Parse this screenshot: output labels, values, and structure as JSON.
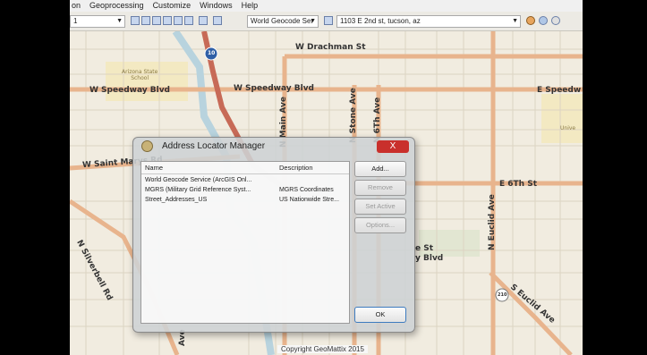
{
  "menubar": {
    "items": [
      "on",
      "Geoprocessing",
      "Customize",
      "Windows",
      "Help"
    ]
  },
  "toolbar": {
    "scale_fragment": "1",
    "locator_combo": "World Geocode Ser",
    "address_combo": "1103 E 2nd st, tucson, az"
  },
  "map": {
    "labels": {
      "drachman": "W Drachman St",
      "school": "Arizona State\nSchool",
      "speedway_w": "W Speedway Blvd",
      "speedway_mid": "W Speedway Blvd",
      "speedway_e": "E Speedw",
      "saint_marys": "W Saint Marys Rd",
      "sixth_e": "E 6Th St",
      "main_ave": "N Main Ave",
      "stone_ave": "N Stone Ave",
      "sixth_ave": "N 6Th Ave",
      "euclid_n": "N Euclid Ave",
      "euclid_s": "S Euclid Ave",
      "silverbell": "N Silverbell Rd",
      "st_frag": "e St",
      "blvd_frag": "y Blvd",
      "ave_frag": "Ave",
      "univ_frag": "Unive",
      "shield_10": "10",
      "shield_210": "210"
    }
  },
  "dialog": {
    "title": "Address Locator Manager",
    "close_label": "X",
    "columns": {
      "name": "Name",
      "description": "Description"
    },
    "rows": [
      {
        "name": "World Geocode Service (ArcGIS Onl...",
        "description": ""
      },
      {
        "name": "MGRS (Military Grid Reference Syst...",
        "description": "MGRS Coordinates"
      },
      {
        "name": "Street_Addresses_US",
        "description": "US Nationwide Stre..."
      }
    ],
    "buttons": {
      "add": "Add...",
      "remove": "Remove",
      "set_active": "Set Active",
      "options": "Options...",
      "ok": "OK"
    }
  },
  "footer": {
    "copyright": "Copyright GeoMattix 2015"
  }
}
